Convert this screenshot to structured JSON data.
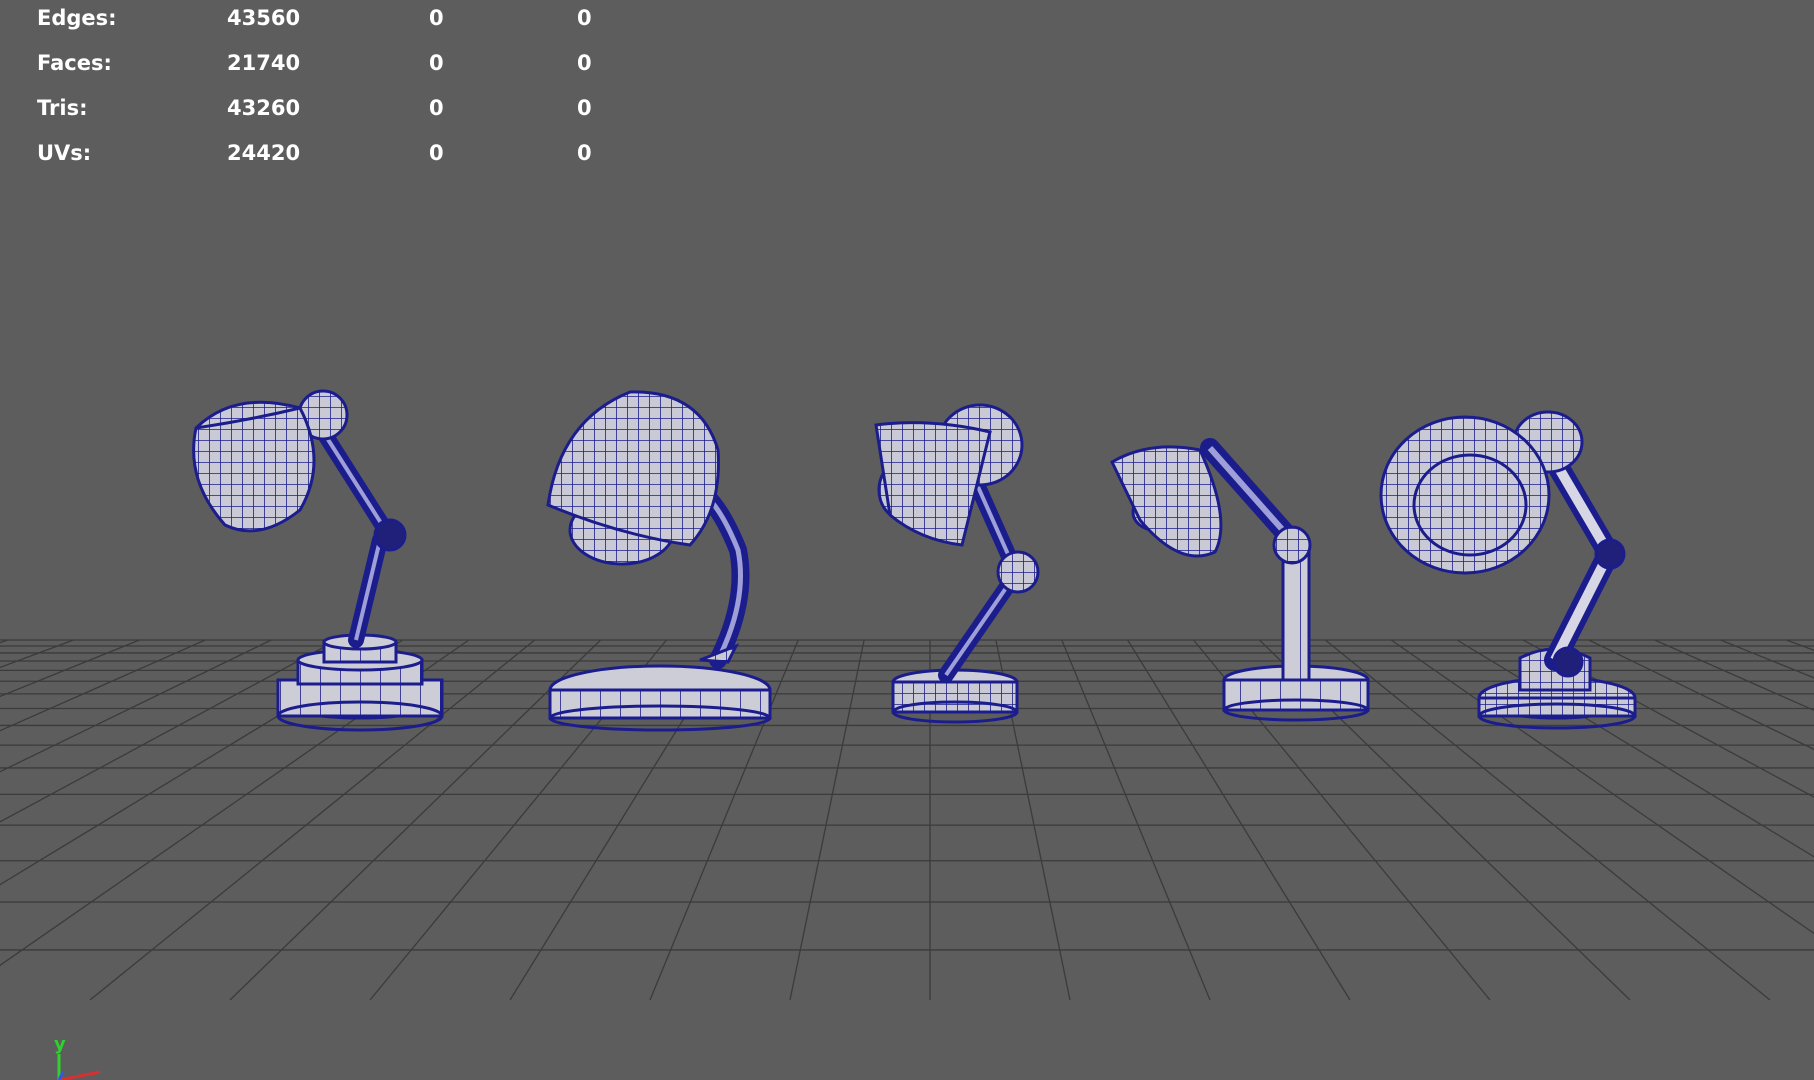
{
  "viewport": {
    "background": "#5d5d5d",
    "wireframe_color": "#1c1d8c",
    "surface_color": "#cacad6",
    "grid_color": "#3b3b3b"
  },
  "poly_count": {
    "rows": [
      {
        "label": "Edges:",
        "v1": "43560",
        "v2": "0",
        "v3": "0"
      },
      {
        "label": "Faces:",
        "v1": "21740",
        "v2": "0",
        "v3": "0"
      },
      {
        "label": "Tris:",
        "v1": "43260",
        "v2": "0",
        "v3": "0"
      },
      {
        "label": "UVs:",
        "v1": "24420",
        "v2": "0",
        "v3": "0"
      }
    ]
  },
  "axis_gizmo": {
    "y_label": "y",
    "y_color": "#2ed12e",
    "x_color": "#d63131",
    "z_color": "#3a56e0"
  }
}
